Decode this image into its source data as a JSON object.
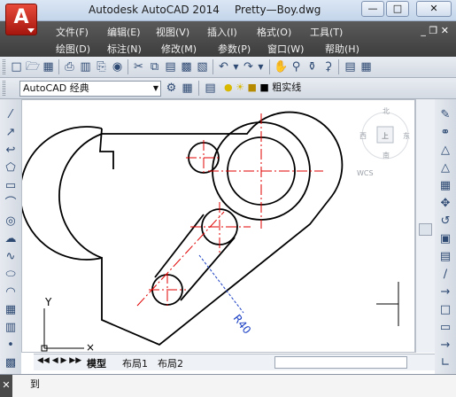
{
  "titlebar": {
    "app_name": "Autodesk AutoCAD 2014",
    "file_name": "Pretty—Boy.dwg",
    "logo_letter": "A",
    "minimize": "—",
    "maximize": "□",
    "close": "✕"
  },
  "menu": {
    "row1": [
      "文件(F)",
      "编辑(E)",
      "视图(V)",
      "插入(I)",
      "格式(O)",
      "工具(T)"
    ],
    "row2": [
      "绘图(D)",
      "标注(N)",
      "修改(M)",
      "参数(P)",
      "窗口(W)",
      "帮助(H)"
    ],
    "window_controls": "_ ❐ ✕"
  },
  "workspace": {
    "name": "AutoCAD 经典",
    "layer": "粗实线"
  },
  "viewcube": {
    "north": "北",
    "west": "西",
    "top": "上",
    "east": "东",
    "south": "南",
    "wcs": "WCS"
  },
  "drawing": {
    "dimension": "R40",
    "ucs_y": "Y"
  },
  "tabs": {
    "model": "模型",
    "layout1": "布局1",
    "layout2": "布局2"
  },
  "command": {
    "text": "到",
    "close": "✕"
  }
}
